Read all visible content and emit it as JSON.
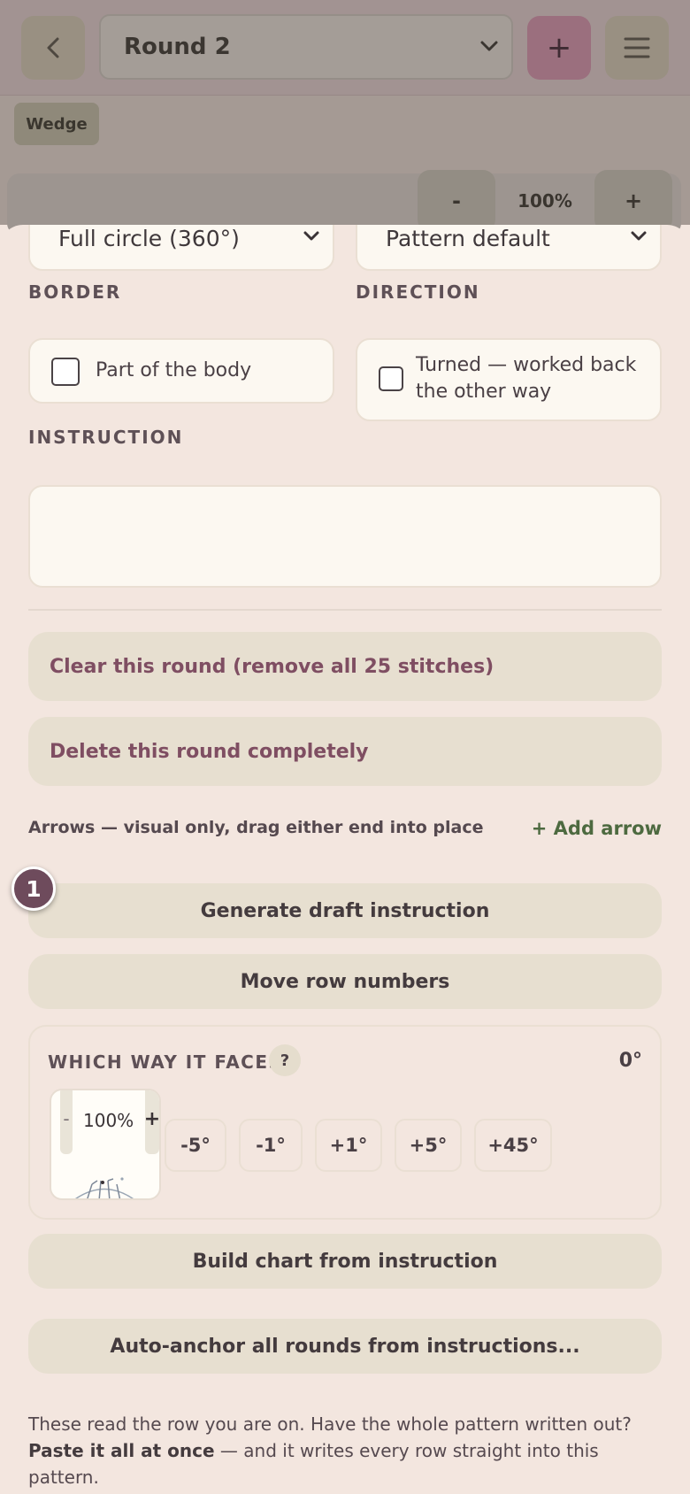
{
  "topbar": {
    "back_icon": "chevron-left-icon",
    "round_value": "Round 2",
    "add_label": "+",
    "menu_icon": "hamburger-menu-icon"
  },
  "tags": {
    "wedge": "Wedge"
  },
  "canvas_zoom": {
    "minus": "-",
    "value": "100%",
    "plus": "+"
  },
  "sheet": {
    "shape_select": "Full circle (360°)",
    "direction_select": "Pattern default",
    "border": {
      "label": "BORDER",
      "checkbox_label": "Part of the body",
      "checked": false
    },
    "direction": {
      "label": "DIRECTION",
      "checkbox_label_line1": "Turned — worked back",
      "checkbox_label_line2": "the other way",
      "checked": false
    },
    "instruction": {
      "label": "INSTRUCTION",
      "value": ""
    },
    "clear_round": "Clear this round (remove all 25 stitches)",
    "delete_round": "Delete this round completely",
    "arrows_hint": "Arrows — visual only, drag either end into place",
    "add_arrow": "+ Add arrow",
    "step_badge": "1",
    "generate_draft": "Generate draft instruction",
    "move_row_numbers": "Move row numbers",
    "faces": {
      "title": "WHICH WAY IT FACES",
      "help": "?",
      "angle": "0°",
      "preview_minus": "-",
      "preview_zoom": "100%",
      "preview_plus": "+",
      "buttons": [
        "-5°",
        "-1°",
        "+1°",
        "+5°",
        "+45°"
      ]
    },
    "build_chart": "Build chart from instruction",
    "auto_anchor": "Auto-anchor all rounds from instructions...",
    "footer_line1": "These read the row you are on. Have the whole pattern written out?",
    "footer_bold": "Paste it all at once",
    "footer_line2_rest": " — and it writes every row straight into this pattern."
  },
  "colors": {
    "accent": "#6e4b5c",
    "danger_text": "#7f4e62",
    "success_text": "#4d6a40",
    "sheet_bg": "#f3e6df"
  }
}
